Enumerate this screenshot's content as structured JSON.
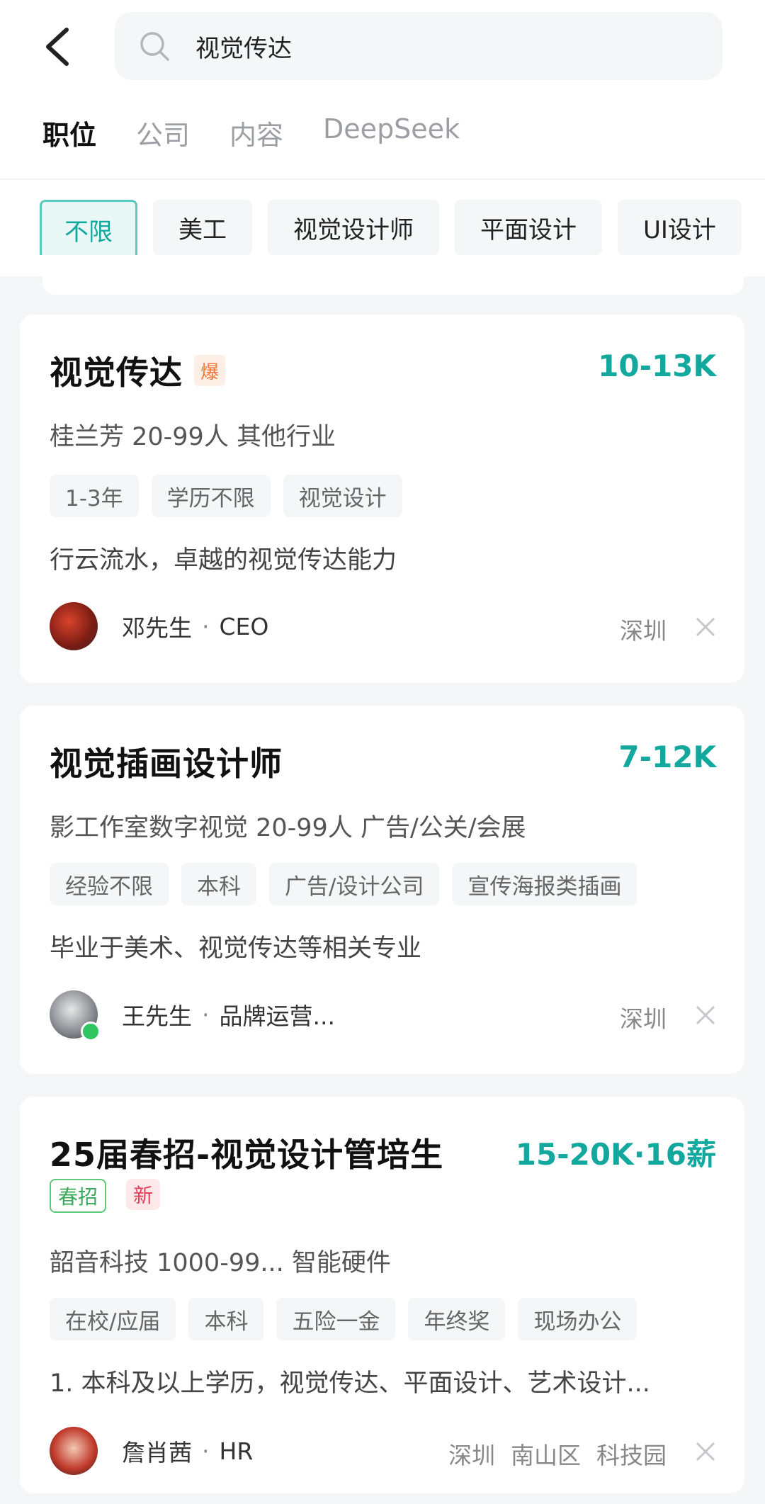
{
  "header": {
    "search_value": "视觉传达",
    "tabs": [
      {
        "label": "职位",
        "active": true
      },
      {
        "label": "公司",
        "active": false
      },
      {
        "label": "内容",
        "active": false
      },
      {
        "label": "DeepSeek",
        "active": false
      }
    ],
    "filters": [
      "不限",
      "美工",
      "视觉设计师",
      "平面设计",
      "UI设计"
    ]
  },
  "jobs": [
    {
      "title": "视觉传达",
      "badge": "爆",
      "salary": "10-13K",
      "company": "桂兰芳  20-99人  其他行业",
      "tags": [
        "1-3年",
        "学历不限",
        "视觉设计"
      ],
      "desc": "行云流水，卓越的视觉传达能力",
      "recruiter_name": "邓先生",
      "recruiter_role": "CEO",
      "location": [
        "深圳"
      ]
    },
    {
      "title": "视觉插画设计师",
      "salary": "7-12K",
      "company": "影工作室数字视觉  20-99人  广告/公关/会展",
      "tags": [
        "经验不限",
        "本科",
        "广告/设计公司",
        "宣传海报类插画"
      ],
      "desc": "毕业于美术、视觉传达等相关专业",
      "recruiter_name": "王先生",
      "recruiter_role": "品牌运营...",
      "location": [
        "深圳"
      ]
    },
    {
      "title": "25届春招-视觉设计管培生",
      "salary": "15-20K·16薪",
      "labels": [
        "春招",
        "新"
      ],
      "company": "韶音科技  1000-99...  智能硬件",
      "tags": [
        "在校/应届",
        "本科",
        "五险一金",
        "年终奖",
        "现场办公"
      ],
      "desc": "1. 本科及以上学历，视觉传达、平面设计、艺术设计...",
      "recruiter_name": "詹肖茜",
      "recruiter_role": "HR",
      "location": [
        "深圳",
        "南山区",
        "科技园"
      ]
    }
  ],
  "colors": {
    "accent": "#13a89e",
    "hot": "#f0753b",
    "new": "#e2415a",
    "spring": "#3aa85a"
  },
  "icons": [
    "back-arrow-icon",
    "search-icon",
    "close-icon"
  ]
}
